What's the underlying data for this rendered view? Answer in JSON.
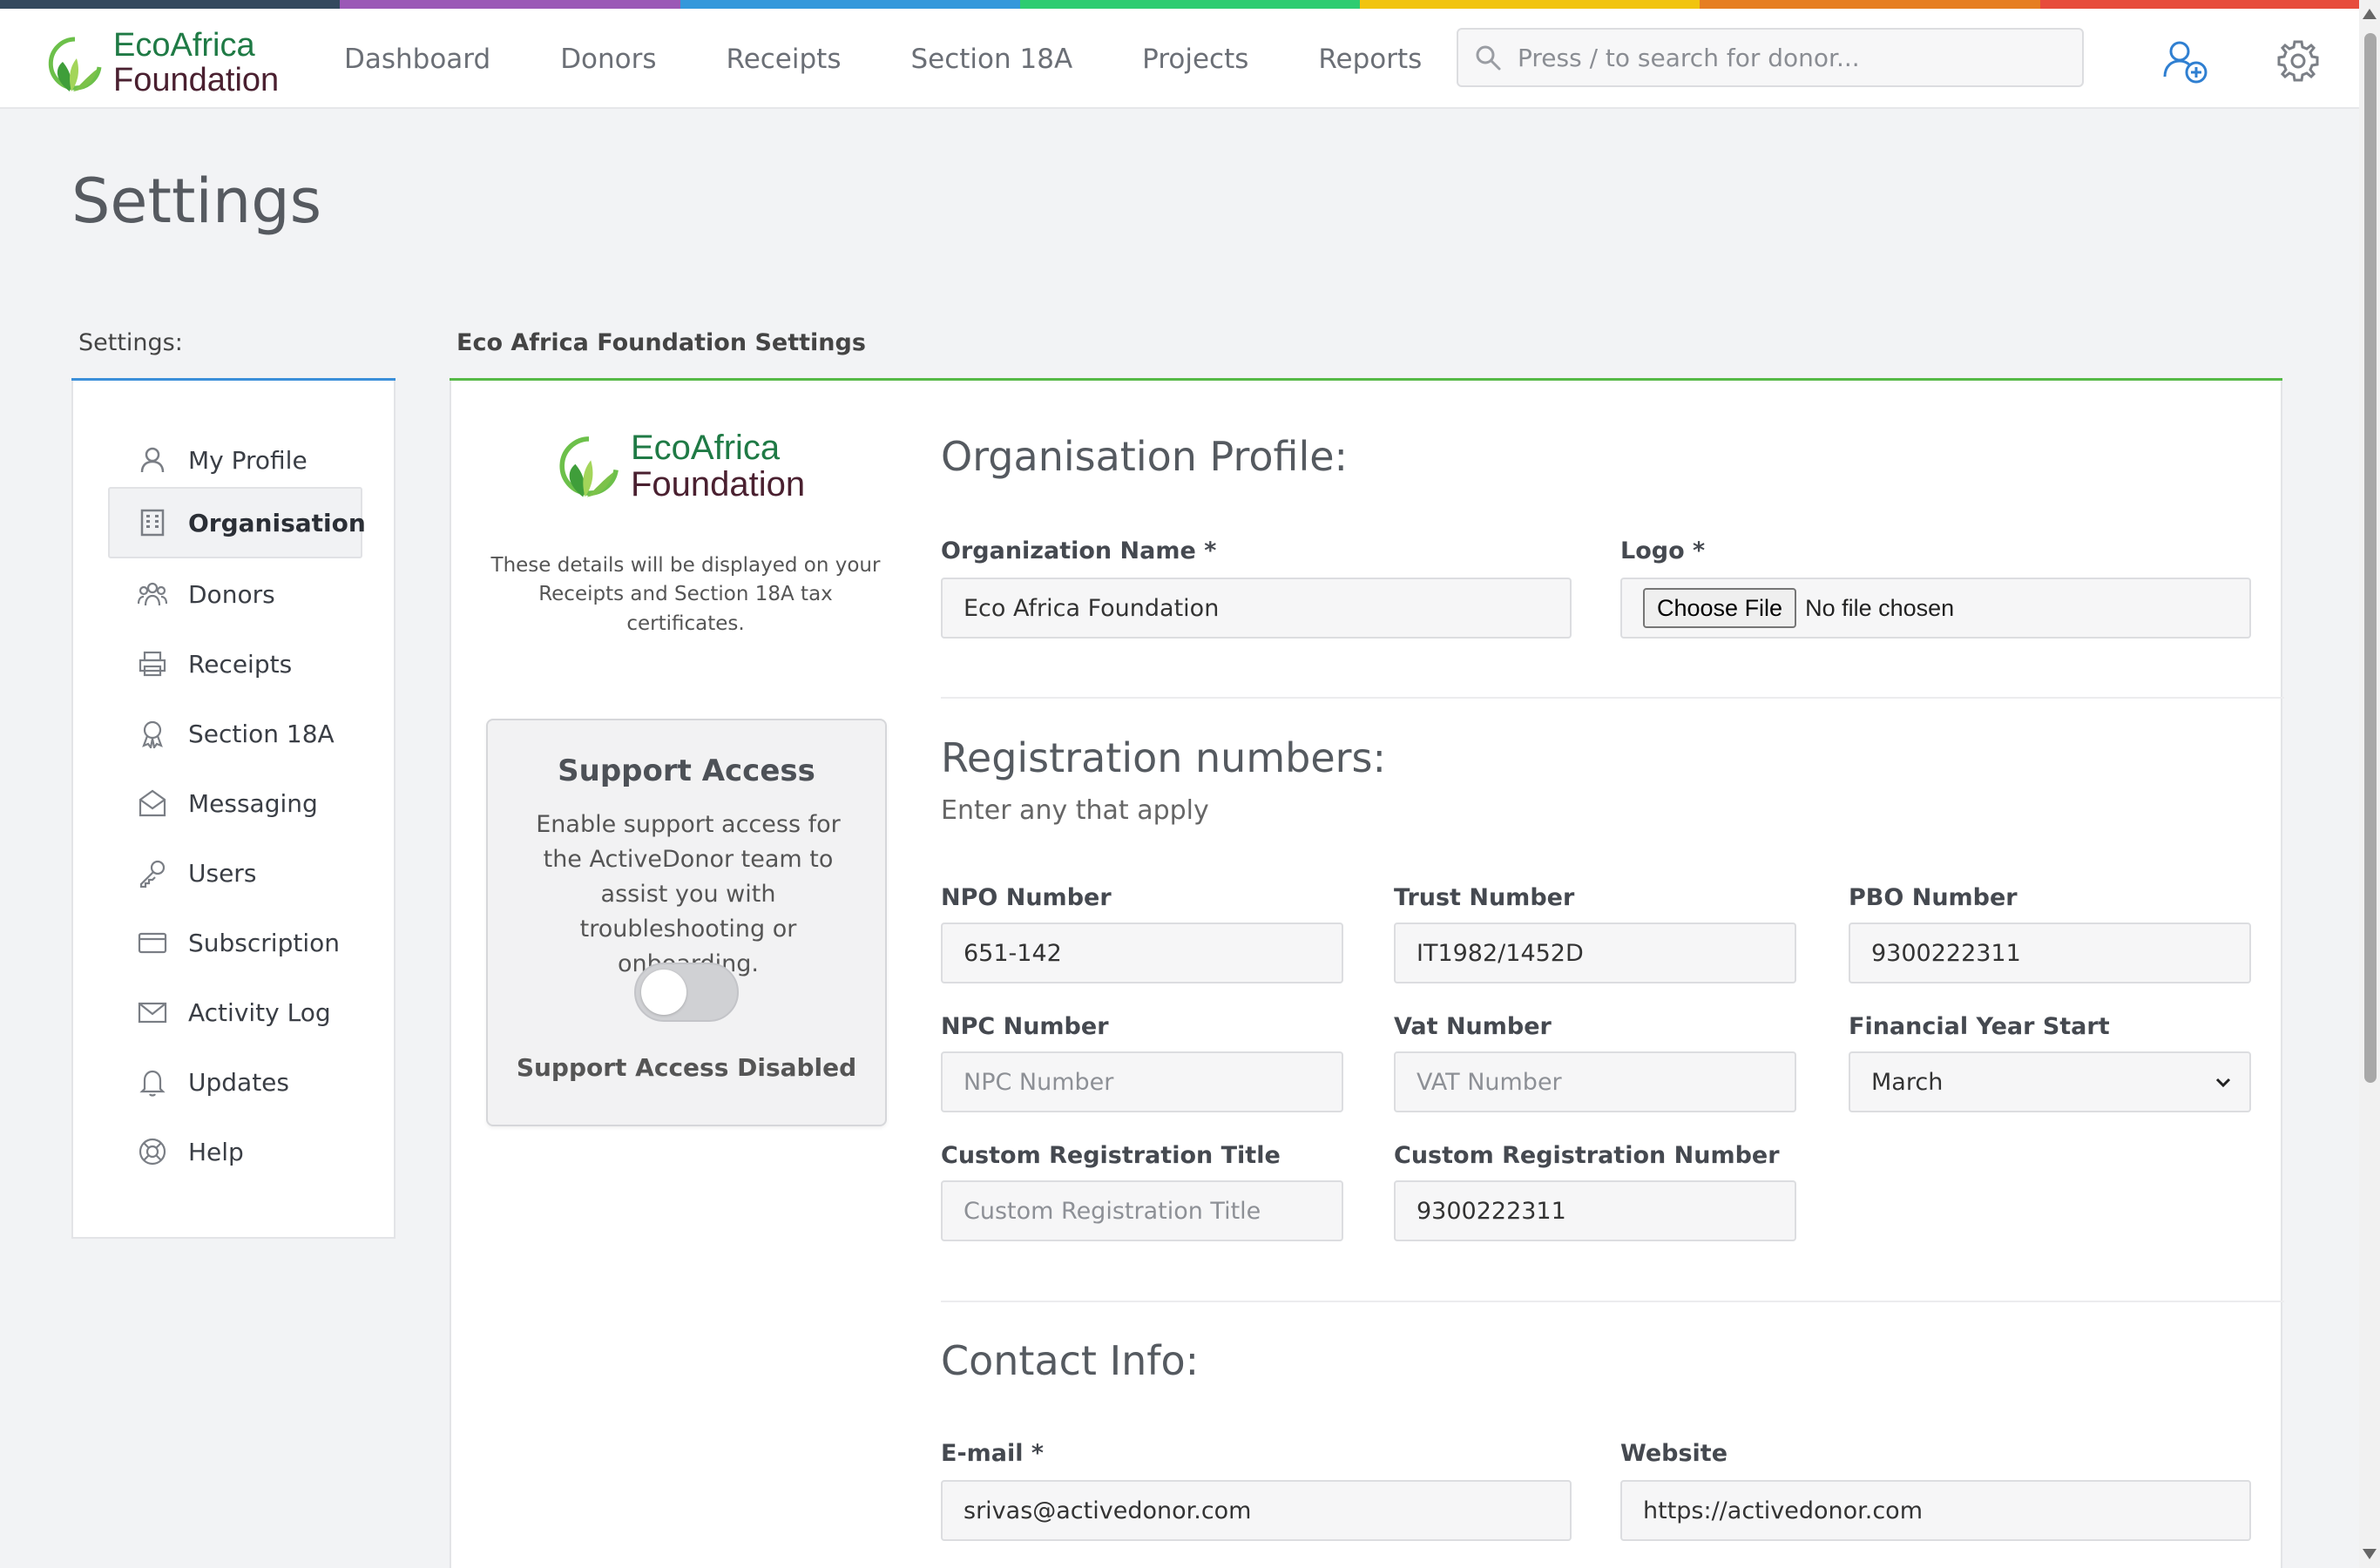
{
  "brand": {
    "line1": "EcoAfrica",
    "line2": "Foundation"
  },
  "nav": {
    "links": [
      "Dashboard",
      "Donors",
      "Receipts",
      "Section 18A",
      "Projects",
      "Reports"
    ],
    "search_placeholder": "Press / to search for donor..."
  },
  "icons": {
    "search": "search-icon",
    "add_user": "add-user-icon",
    "settings": "gear-icon"
  },
  "colors": {
    "rainbow": [
      "#34495e",
      "#9b59b6",
      "#3498db",
      "#2ecc71",
      "#f1c40f",
      "#e67e22",
      "#e74c3c"
    ],
    "accent_blue": "#3b8fd9",
    "accent_green": "#56b947"
  },
  "page": {
    "title": "Settings"
  },
  "sidebar": {
    "label": "Settings:",
    "items": [
      {
        "label": "My Profile",
        "icon": "user-icon"
      },
      {
        "label": "Organisation",
        "icon": "building-icon",
        "active": true
      },
      {
        "label": "Donors",
        "icon": "users-icon"
      },
      {
        "label": "Receipts",
        "icon": "printer-icon"
      },
      {
        "label": "Section 18A",
        "icon": "award-icon"
      },
      {
        "label": "Messaging",
        "icon": "envelope-open-icon"
      },
      {
        "label": "Users",
        "icon": "key-icon"
      },
      {
        "label": "Subscription",
        "icon": "credit-card-icon"
      },
      {
        "label": "Activity Log",
        "icon": "mail-icon"
      },
      {
        "label": "Updates",
        "icon": "bell-icon"
      },
      {
        "label": "Help",
        "icon": "lifebuoy-icon"
      }
    ]
  },
  "main": {
    "header": "Eco Africa Foundation Settings",
    "note": "These details will be displayed on your Receipts and Section 18A tax certificates.",
    "support": {
      "title": "Support Access",
      "text": "Enable support access for the ActiveDonor team to assist you with troubleshooting or onboarding.",
      "enabled": false,
      "status": "Support Access Disabled"
    },
    "org_profile": {
      "title": "Organisation Profile:",
      "name_label": "Organization Name *",
      "name_value": "Eco Africa Foundation",
      "logo_label": "Logo *",
      "logo_button": "Choose File",
      "logo_status": "No file chosen"
    },
    "registration": {
      "title": "Registration numbers:",
      "subtitle": "Enter any that apply",
      "npo_label": "NPO Number",
      "npo_value": "651-142",
      "trust_label": "Trust Number",
      "trust_value": "IT1982/1452D",
      "pbo_label": "PBO Number",
      "pbo_value": "9300222311",
      "npc_label": "NPC Number",
      "npc_placeholder": "NPC Number",
      "vat_label": "Vat Number",
      "vat_placeholder": "VAT Number",
      "fy_label": "Financial Year Start",
      "fy_value": "March",
      "custom_title_label": "Custom Registration Title",
      "custom_title_placeholder": "Custom Registration Title",
      "custom_number_label": "Custom Registration Number",
      "custom_number_value": "9300222311"
    },
    "contact": {
      "title": "Contact Info:",
      "email_label": "E-mail *",
      "email_value": "srivas@activedonor.com",
      "website_label": "Website",
      "website_value": "https://activedonor.com"
    }
  }
}
